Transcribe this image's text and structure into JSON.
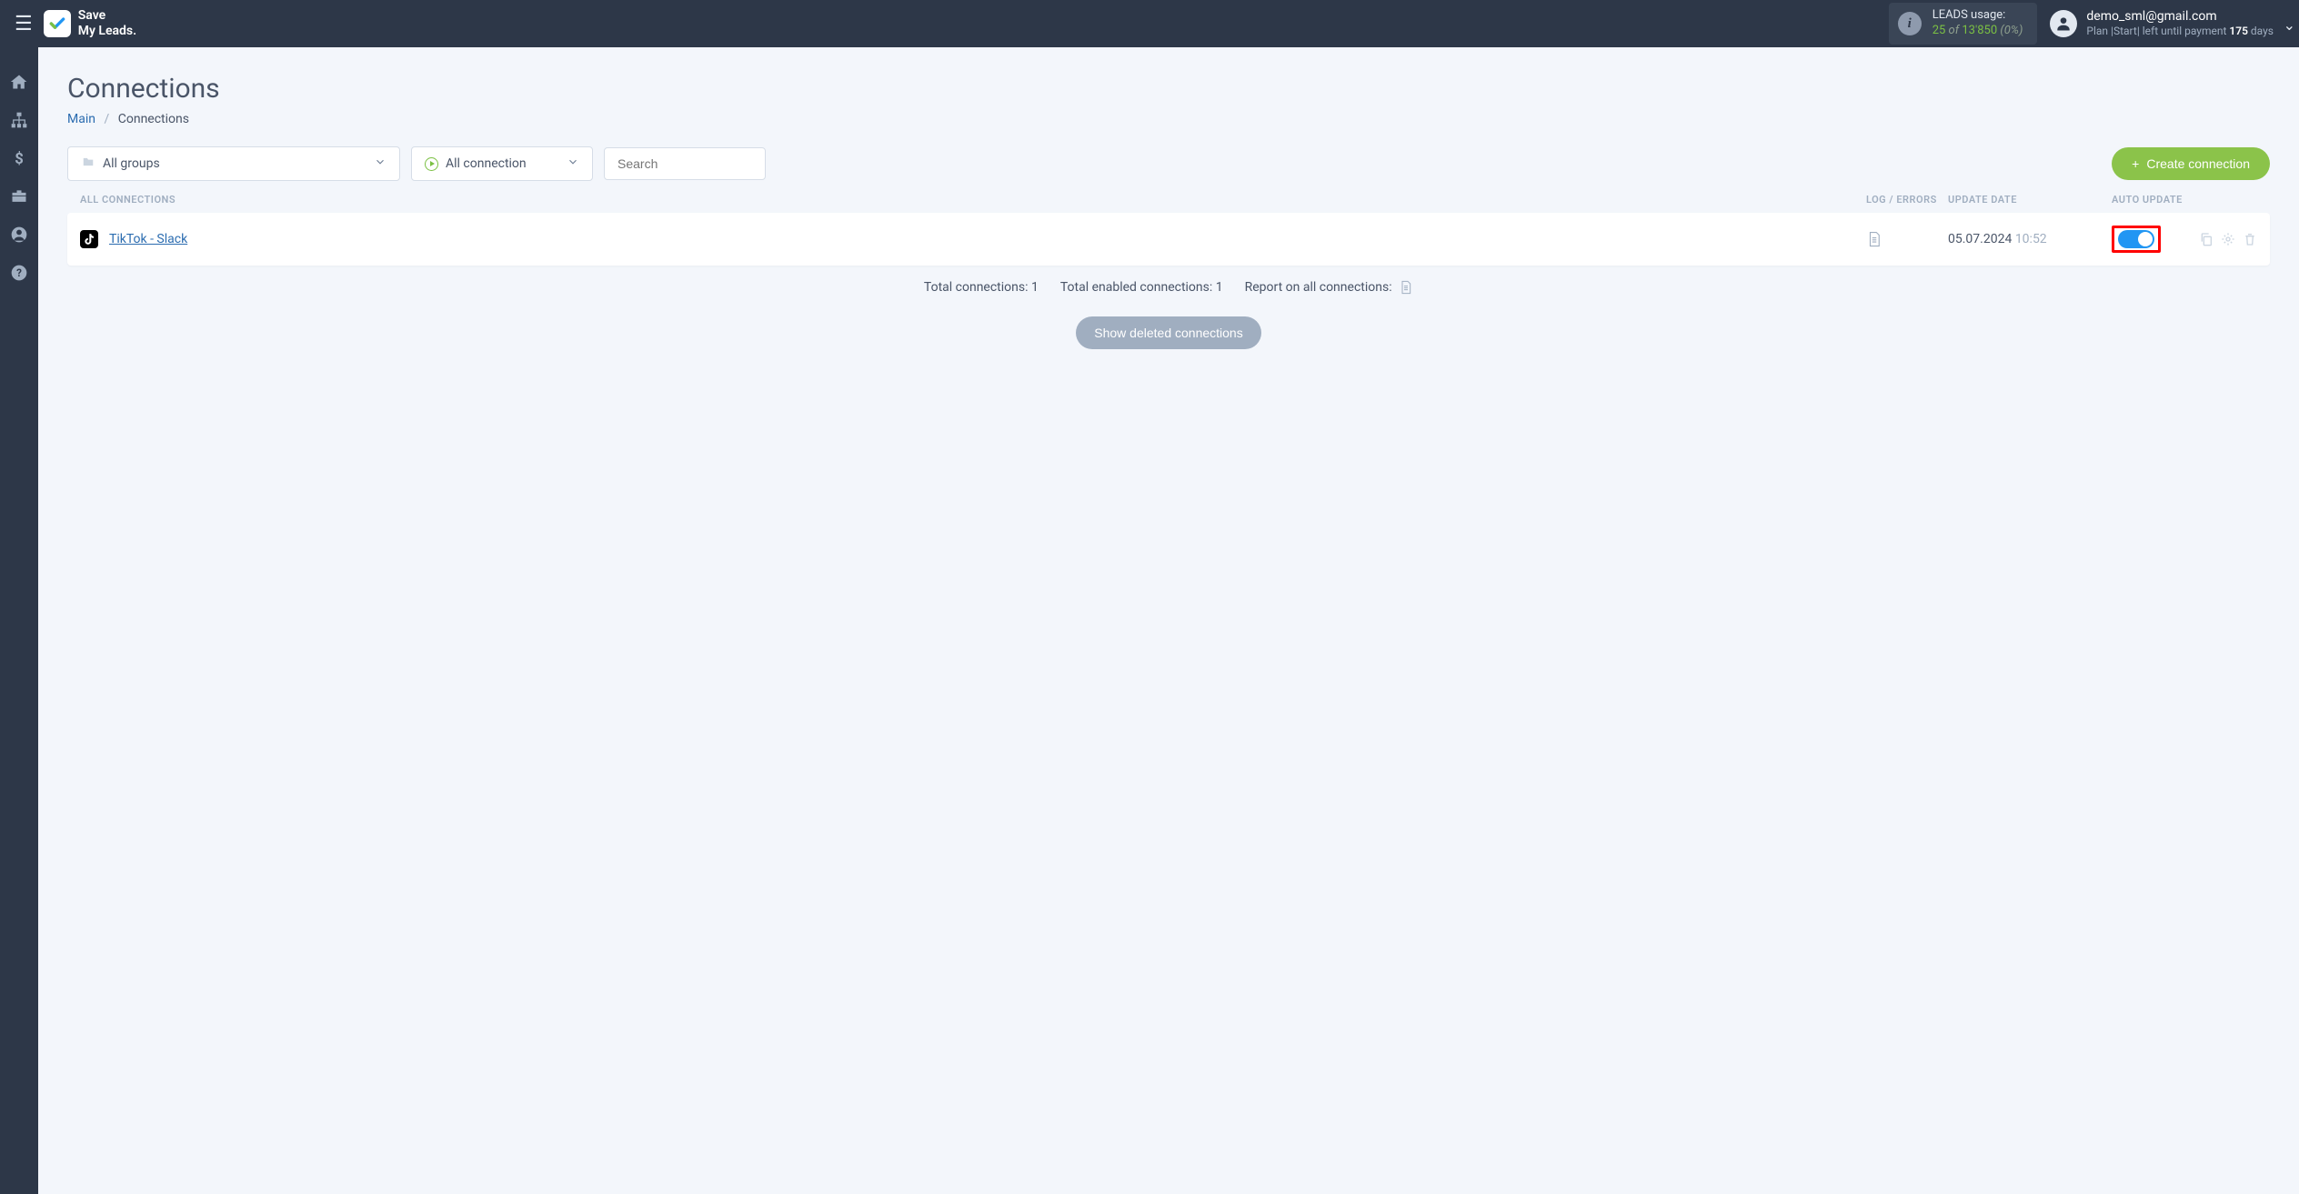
{
  "header": {
    "logo_text": "Save\nMy Leads.",
    "leads_usage_label": "LEADS usage:",
    "leads_used": "25",
    "leads_of": "of",
    "leads_total": "13'850",
    "leads_percent": "(0%)",
    "user_email": "demo_sml@gmail.com",
    "plan_prefix": "Plan |",
    "plan_name": "Start",
    "plan_suffix": "| left until payment ",
    "days_left": "175",
    "days_word": " days"
  },
  "page": {
    "title": "Connections",
    "breadcrumb_main": "Main",
    "breadcrumb_current": "Connections"
  },
  "filters": {
    "groups_label": "All groups",
    "status_label": "All connection",
    "search_placeholder": "Search",
    "create_button": "Create connection"
  },
  "table": {
    "header_name": "ALL CONNECTIONS",
    "header_log": "LOG / ERRORS",
    "header_date": "UPDATE DATE",
    "header_auto": "AUTO UPDATE"
  },
  "connections": [
    {
      "name": "TikTok - Slack",
      "date": "05.07.2024",
      "time": "10:52"
    }
  ],
  "stats": {
    "total_label": "Total connections: ",
    "total_value": "1",
    "enabled_label": "Total enabled connections: ",
    "enabled_value": "1",
    "report_label": "Report on all connections: "
  },
  "show_deleted": "Show deleted connections"
}
